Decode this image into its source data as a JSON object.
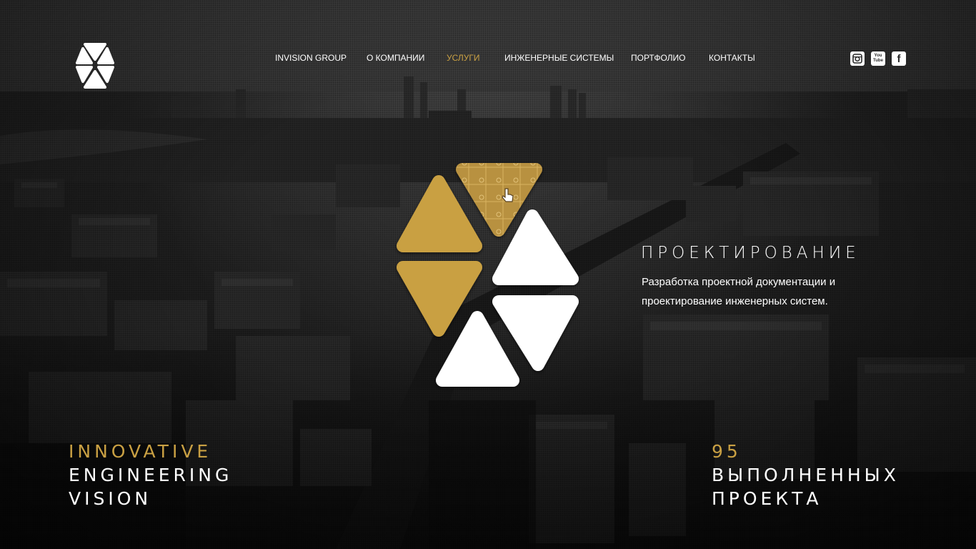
{
  "brand": {
    "logo_icon": "hexagon-triangles-logo"
  },
  "nav": {
    "items": [
      {
        "label": "INVISION GROUP",
        "active": false
      },
      {
        "label": "О КОМПАНИИ",
        "active": false
      },
      {
        "label": "УСЛУГИ",
        "active": true
      },
      {
        "label": "ИНЖЕНЕРНЫЕ СИСТЕМЫ",
        "active": false
      },
      {
        "label": "ПОРТФОЛИО",
        "active": false
      },
      {
        "label": "КОНТАКТЫ",
        "active": false
      }
    ]
  },
  "social": {
    "instagram_icon": "instagram-icon",
    "youtube_line1": "You",
    "youtube_line2": "Tube",
    "facebook_glyph": "f"
  },
  "service": {
    "title": "ПРОЕКТИРОВАНИЕ",
    "description_line1": "Разработка проектной документации и",
    "description_line2": "проектирование инженерных систем."
  },
  "tagline": {
    "line1": "INNOVATIVE",
    "line2": "ENGINEERING",
    "line3": "VISION"
  },
  "counter": {
    "number": "95",
    "line1": "ВЫПОЛНЕННЫХ",
    "line2": "ПРОЕКТА"
  },
  "colors": {
    "accent_gold": "#c9a043",
    "text_white": "#ffffff",
    "background": "#1e1e1e"
  }
}
